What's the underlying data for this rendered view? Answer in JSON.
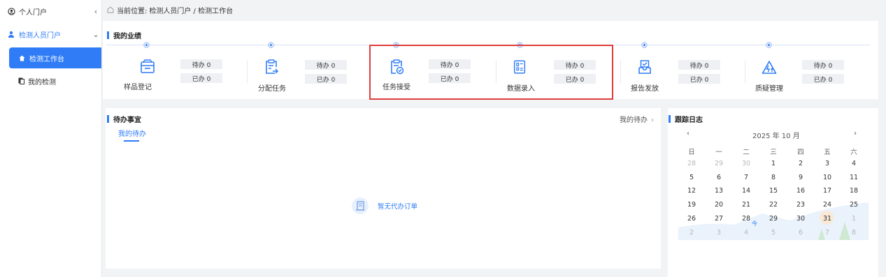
{
  "sidebar": {
    "personal_portal": "个人门户",
    "inspector_portal": "检测人员门户",
    "workbench": "检测工作台",
    "my_tests": "我的检测"
  },
  "breadcrumb": {
    "prefix": "当前位置:",
    "path": "检测人员门户 / 检测工作台"
  },
  "performance": {
    "title": "我的业绩",
    "items": [
      {
        "name": "样品登记",
        "icon": "box-icon",
        "pending": "待办 0",
        "done": "已办 0"
      },
      {
        "name": "分配任务",
        "icon": "assign-icon",
        "pending": "待办 0",
        "done": "已办 0"
      },
      {
        "name": "任务接受",
        "icon": "clipboard-check-icon",
        "pending": "待办 0",
        "done": "已办 0"
      },
      {
        "name": "数据录入",
        "icon": "data-entry-icon",
        "pending": "待办 0",
        "done": "已办 0"
      },
      {
        "name": "报告发放",
        "icon": "inbox-icon",
        "pending": "待办 0",
        "done": "已办 0"
      },
      {
        "name": "质疑管理",
        "icon": "alert-icon",
        "pending": "待办 0",
        "done": "已办 0"
      }
    ]
  },
  "todo": {
    "title": "待办事宜",
    "tab": "我的待办",
    "more": "我的待办",
    "empty": "暂无代办订单"
  },
  "log": {
    "title": "跟踪日志",
    "month": "2025 年 10 月",
    "weekdays": [
      "日",
      "一",
      "二",
      "三",
      "四",
      "五",
      "六"
    ],
    "rows": [
      [
        "28",
        "29",
        "30",
        "1",
        "2",
        "3",
        "4"
      ],
      [
        "5",
        "6",
        "7",
        "8",
        "9",
        "10",
        "11"
      ],
      [
        "12",
        "13",
        "14",
        "15",
        "16",
        "17",
        "18"
      ],
      [
        "19",
        "20",
        "21",
        "22",
        "23",
        "24",
        "25"
      ],
      [
        "26",
        "27",
        "28",
        "29",
        "30",
        "31",
        "1"
      ],
      [
        "2",
        "3",
        "4",
        "5",
        "6",
        "7",
        "8"
      ]
    ],
    "today_mark": "今"
  },
  "colors": {
    "accent": "#2f7cf6",
    "highlight_box": "#e03c3c"
  }
}
